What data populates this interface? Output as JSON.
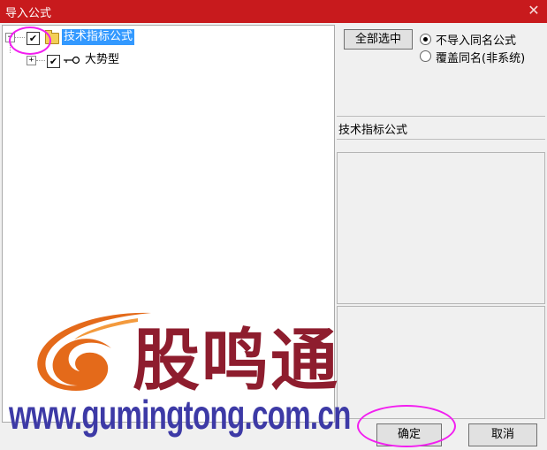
{
  "window": {
    "title": "导入公式"
  },
  "tree": {
    "nodes": [
      {
        "label": "技术指标公式",
        "checked": true,
        "selected": true
      },
      {
        "label": "大势型",
        "checked": true,
        "selected": false
      }
    ]
  },
  "controls": {
    "select_all_label": "全部选中",
    "radio_options": [
      {
        "label": "不导入同名公式",
        "selected": true
      },
      {
        "label": "覆盖同名(非系统)",
        "selected": false
      }
    ]
  },
  "detail": {
    "name": "技术指标公式"
  },
  "watermark": {
    "brand": "股鸣通",
    "url": "www.gumingtong.com.cn"
  },
  "buttons": {
    "ok_label": "确定",
    "cancel_label": "取消"
  },
  "colors": {
    "titlebar": "#c81a1d",
    "selection": "#3399ff",
    "highlight_circle": "#f21ef0",
    "brand": "#8e1d2e",
    "url": "#3d3aa6"
  }
}
